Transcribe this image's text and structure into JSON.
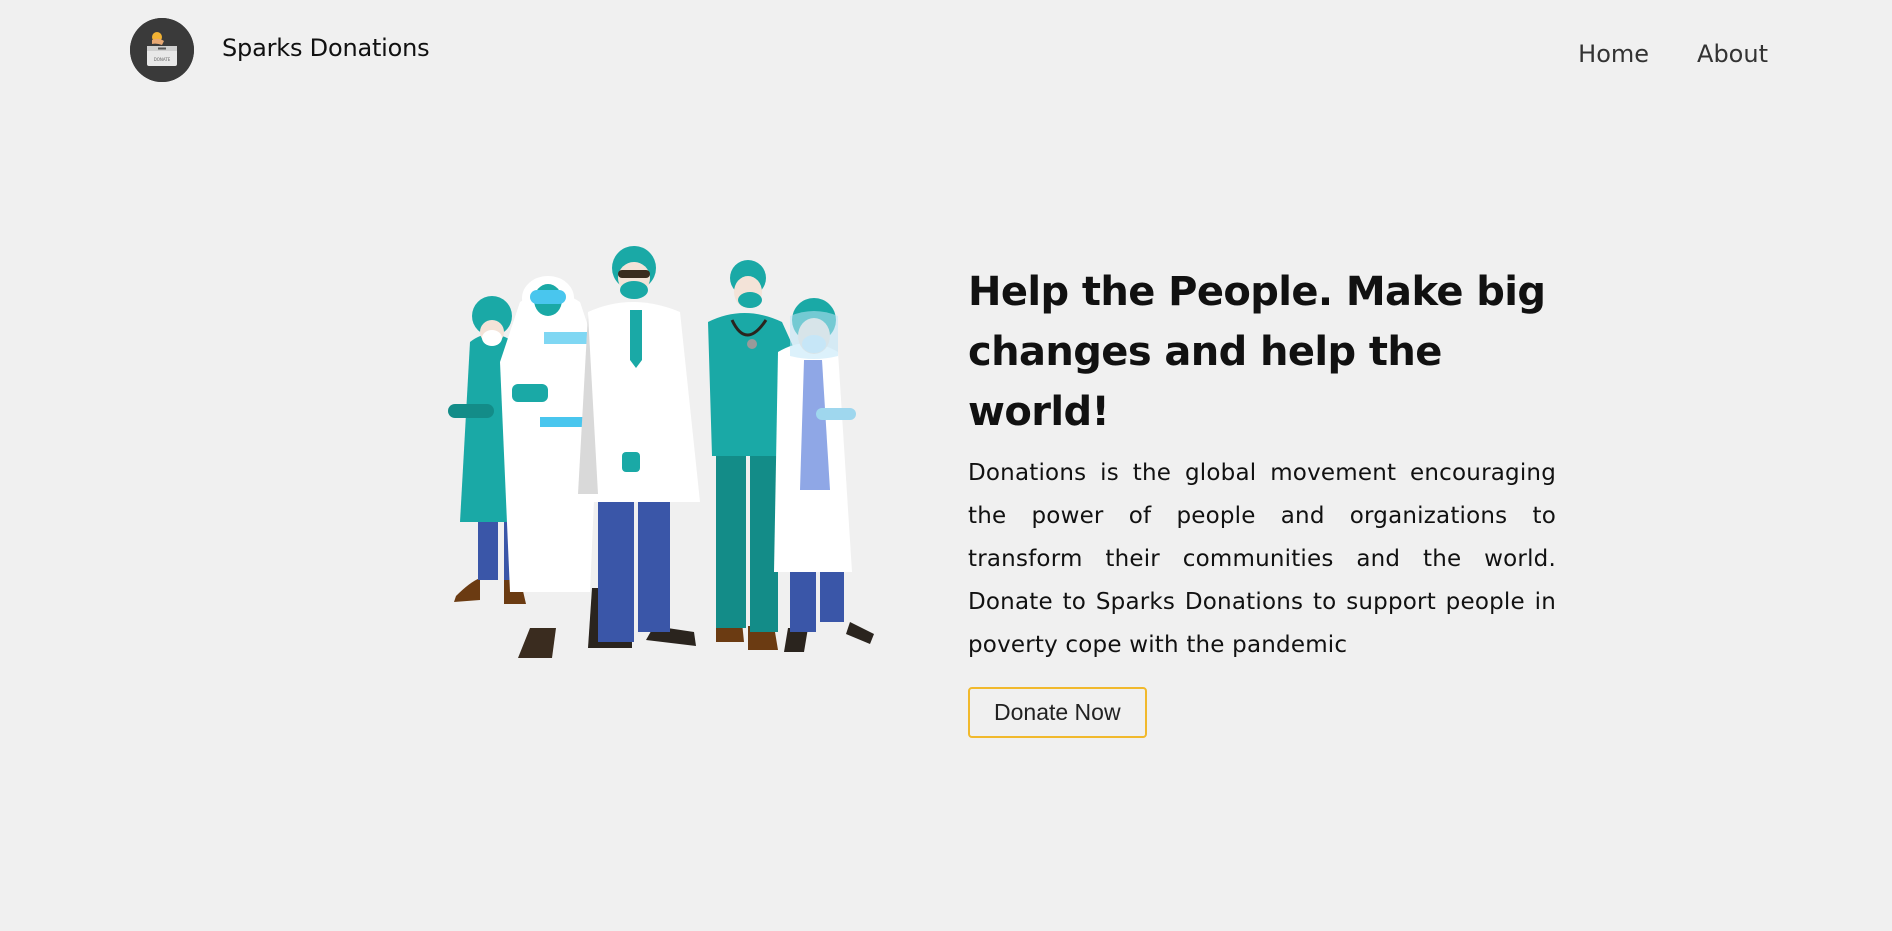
{
  "header": {
    "brand": "Sparks Donations",
    "logo_icon": "donation-box-icon",
    "logo_text": "DONATE",
    "nav": [
      {
        "label": "Home"
      },
      {
        "label": "About"
      }
    ]
  },
  "hero": {
    "headline": "Help the People. Make big changes and help the world!",
    "description": "Donations is the global movement encouraging the power of people and organizations to transform their communities and the world. Donate to Sparks Donations to support people in poverty cope with the pandemic",
    "button_label": "Donate Now",
    "illustration": "healthcare-workers-illustration"
  },
  "colors": {
    "background": "#f0f0f0",
    "accent": "#f1b92c",
    "teal": "#1aa9a6",
    "blue_pants": "#3a56a8",
    "logo_bg": "#3a3a3a"
  }
}
